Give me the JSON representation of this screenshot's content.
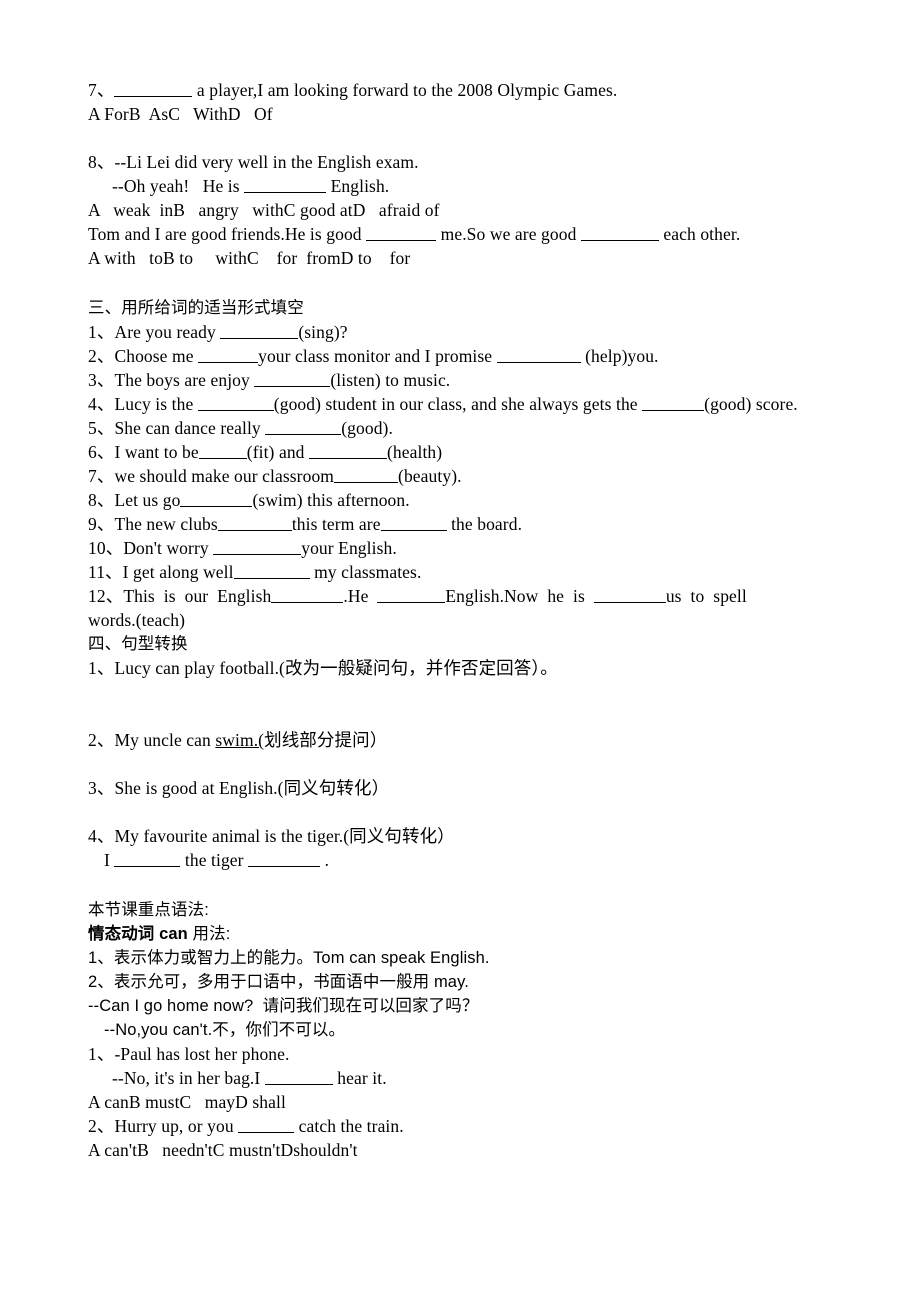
{
  "document": {
    "language": "English exercise worksheet (Chinese annotations)",
    "section_two_tail": {
      "q7": {
        "number": "7、",
        "text_before_blank": "",
        "text_after_blank": " a player,I am looking forward to the 2008 Olympic Games.",
        "options": [
          "A For",
          "B  As",
          "C   With",
          "D   Of"
        ]
      },
      "q8": {
        "number": "8、",
        "line1": "--Li Lei did very well in the English exam.",
        "line2_before": "--Oh yeah!   He is ",
        "line2_after": " English.",
        "options": [
          "A   weak  in",
          "B   angry   with",
          "C good at",
          "D   afraid of"
        ]
      },
      "q9": {
        "line_part1": "Tom and I are good friends.He is good ",
        "line_part2": " me.So we are good ",
        "line_part3": " each other.",
        "options": [
          "A with   to",
          "B to     with",
          "C    for  from",
          "D to    for"
        ]
      }
    },
    "section_three": {
      "heading": "三、用所给词的适当形式填空",
      "items": [
        {
          "number": "1、",
          "parts": [
            "Are you ready ",
            "(sing)?"
          ]
        },
        {
          "number": "2、",
          "parts": [
            "Choose me ",
            "your class monitor and I promise ",
            " (help)you."
          ]
        },
        {
          "number": "3、",
          "parts": [
            "The boys are enjoy ",
            "(listen) to music."
          ]
        },
        {
          "number": "4、",
          "parts": [
            "Lucy is the ",
            "(good) student in our class, and she always gets the ",
            "(good) score."
          ]
        },
        {
          "number": "5、",
          "parts": [
            "She can dance really ",
            "(good)."
          ]
        },
        {
          "number": "6、",
          "parts": [
            "I want to be",
            "(fit) and ",
            "(health)"
          ]
        },
        {
          "number": "7、",
          "parts": [
            "we should make our classroom",
            "(beauty)."
          ]
        },
        {
          "number": "8、",
          "parts": [
            "Let us go",
            "(swim) this afternoon."
          ]
        },
        {
          "number": "9、",
          "parts": [
            "The new clubs",
            "this term are",
            " the board."
          ]
        },
        {
          "number": "10、",
          "parts": [
            "Don't worry ",
            "your English."
          ]
        },
        {
          "number": "11、",
          "parts": [
            "I get along well",
            " my classmates."
          ]
        },
        {
          "number": "12、",
          "parts": [
            "This  is  our  English",
            ".He  ",
            "English.Now  he  is  ",
            "us  to  spell"
          ],
          "wrap": "words.(teach)"
        }
      ]
    },
    "section_four": {
      "heading": "四、句型转换",
      "items": [
        {
          "number": "1、",
          "text": "Lucy can play football.(改为一般疑问句，并作否定回答）。"
        },
        {
          "number": "2、",
          "text_before": "My uncle can ",
          "underlined": "swim.(",
          "text_after": "划线部分提问）"
        },
        {
          "number": "3、",
          "text": "She is good at English.(同义句转化）"
        },
        {
          "number": "4、",
          "text": "My favourite animal is the tiger.(同义句转化）",
          "answer_line": {
            "prefix": "I ",
            "middle": " the tiger ",
            "suffix": " ."
          }
        }
      ]
    },
    "grammar": {
      "title": "本节课重点语法:",
      "subtitle_bold": "情态动词 can",
      "subtitle_rest": " 用法:",
      "points": [
        "1、表示体力或智力上的能力。Tom can speak English.",
        "2、表示允可，多用于口语中，书面语中一般用 may.",
        "--Can I go home now?  请问我们现在可以回家了吗？",
        "--No,you can't.不，你们不可以。"
      ],
      "practice": [
        {
          "number": "1、",
          "line1": "-Paul has lost her phone.",
          "line2_before": "--No, it's in her bag.I ",
          "line2_after": " hear it.",
          "options": [
            "A can",
            "B must",
            "C   may",
            "D shall"
          ]
        },
        {
          "number": "2、",
          "line1_before": "Hurry up, or you ",
          "line1_after": " catch the train.",
          "options": [
            "A can't",
            "B   needn't",
            "C mustn't",
            "Dshouldn't"
          ]
        }
      ]
    }
  }
}
